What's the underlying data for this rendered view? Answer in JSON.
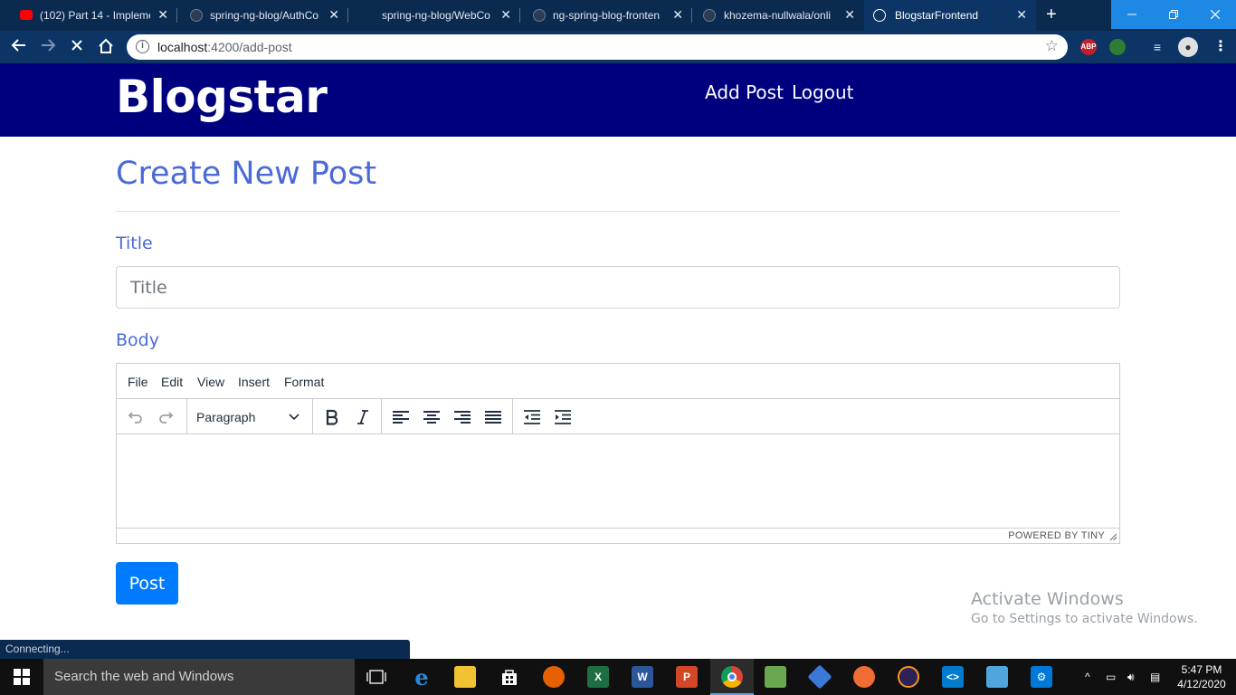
{
  "browser": {
    "tabs": [
      {
        "label": "(102) Part 14 - Impleme",
        "icon": "youtube-icon",
        "color": "#ff0000"
      },
      {
        "label": "spring-ng-blog/AuthCo",
        "icon": "github-icon",
        "color": "#333333"
      },
      {
        "label": "spring-ng-blog/WebCo",
        "icon": "github-icon",
        "color": "#333333"
      },
      {
        "label": "ng-spring-blog-fronten",
        "icon": "github-icon",
        "color": "#333333"
      },
      {
        "label": "khozema-nullwala/onli",
        "icon": "github-icon",
        "color": "#333333"
      },
      {
        "label": "BlogstarFrontend",
        "icon": "angular-icon",
        "color": "#ffffff",
        "active": true
      }
    ],
    "url_host": "localhost",
    "url_path": ":4200/add-post",
    "close_glyph": "✕",
    "new_tab_glyph": "+"
  },
  "header": {
    "brand": "Blogstar",
    "nav": {
      "add_post": "Add Post",
      "logout": "Logout"
    },
    "background": "#00007f"
  },
  "form": {
    "heading": "Create New Post",
    "title_label": "Title",
    "title_placeholder": "Title",
    "title_value": "",
    "body_label": "Body",
    "submit_label": "Post",
    "accent": "#4a6bd6",
    "button_color": "#007bff"
  },
  "editor": {
    "menu": [
      "File",
      "Edit",
      "View",
      "Insert",
      "Format"
    ],
    "block_format": "Paragraph",
    "powered_by": "POWERED BY TINY"
  },
  "status": {
    "loading": "Connecting..."
  },
  "watermark": {
    "line1": "Activate Windows",
    "line2": "Go to Settings to activate Windows."
  },
  "taskbar": {
    "search_placeholder": "Search the web and Windows",
    "time": "5:47 PM",
    "date": "4/12/2020"
  }
}
